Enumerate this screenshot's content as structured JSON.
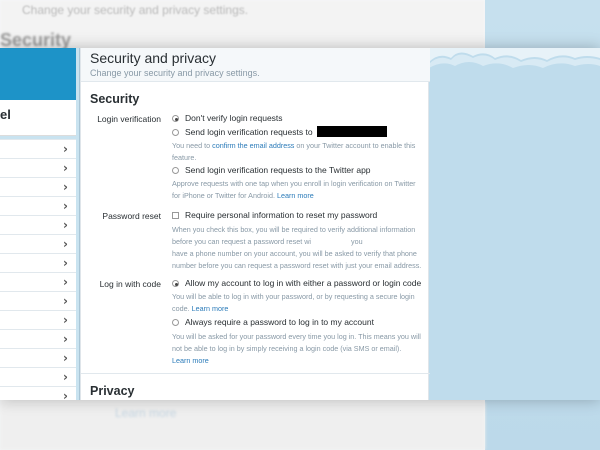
{
  "background": {
    "top_text": "Change your security and privacy settings.",
    "top_title": "Security",
    "bottom_link": "Learn more"
  },
  "sidebar": {
    "profile_name": "el",
    "nav_count": 14
  },
  "header": {
    "title": "Security and privacy",
    "subtitle": "Change your security and privacy settings."
  },
  "security": {
    "heading": "Security",
    "login_verification": {
      "label": "Login verification",
      "options": [
        {
          "label": "Don't verify login requests",
          "selected": true
        },
        {
          "label": "Send login verification requests to",
          "selected": false
        },
        {
          "label": "Send login verification requests to the Twitter app",
          "selected": false
        }
      ],
      "help1_pre": "You need to ",
      "help1_link": "confirm the email address",
      "help1_post": " on your Twitter account to enable this feature.",
      "help2": "Approve requests with one tap when you enroll in login verification on Twitter for iPhone or Twitter for Android.",
      "help2_link": "Learn more"
    },
    "password_reset": {
      "label": "Password reset",
      "checkbox_label": "Require personal information to reset my password",
      "checked": false,
      "help_line1": "When you check this box, you will be required to verify additional information",
      "help_line2a": "before you can request a password reset wi",
      "help_line2b": "you",
      "help_line3": "have a phone number on your account, you will be asked to verify that phone",
      "help_line4": "number before you can request a password reset with just your email address."
    },
    "login_with_code": {
      "label": "Log in with code",
      "options": [
        {
          "label": "Allow my account to log in with either a password or login code",
          "selected": true
        },
        {
          "label": "Always require a password to log in to my account",
          "selected": false
        }
      ],
      "help1": "You will be able to log in with your password, or by requesting a secure login code.",
      "help1_link": "Learn more",
      "help2": "You will be asked for your password every time you log in. This means you will not be able to log in by simply receiving a login code (via SMS or email).",
      "help2_link": "Learn more"
    }
  },
  "privacy": {
    "heading": "Privacy"
  }
}
